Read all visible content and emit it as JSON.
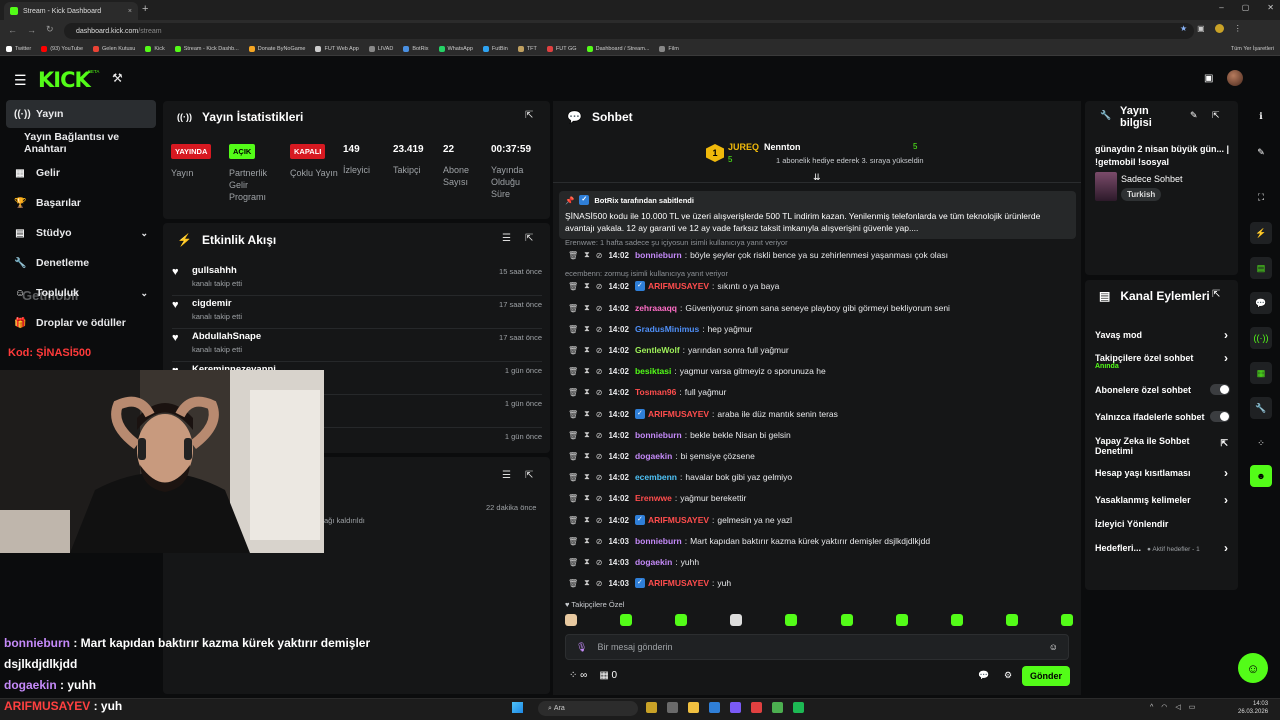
{
  "browser": {
    "tab_title": "Stream - Kick Dashboard",
    "tab_close": "×",
    "new_tab": "+",
    "url_host": "dashboard.kick.com",
    "url_path": "/stream",
    "window_controls": [
      "–",
      "▢",
      "✕"
    ],
    "bookmarks": [
      {
        "label": "Twitter",
        "color": "#ffffff"
      },
      {
        "label": "(93) YouTube",
        "color": "#ff0000"
      },
      {
        "label": "Gelen Kutusu",
        "color": "#ea4335"
      },
      {
        "label": "Kick",
        "color": "#53fc18"
      },
      {
        "label": "Stream - Kick Dashb...",
        "color": "#53fc18"
      },
      {
        "label": "Donate ByNoGame",
        "color": "#f5a623"
      },
      {
        "label": "FUT Web App",
        "color": "#cccccc"
      },
      {
        "label": "LIVAD",
        "color": "#888888"
      },
      {
        "label": "BotRix",
        "color": "#4a90e2"
      },
      {
        "label": "WhatsApp",
        "color": "#25d366"
      },
      {
        "label": "FutBin",
        "color": "#2ea3f2"
      },
      {
        "label": "TFT",
        "color": "#c0a060"
      },
      {
        "label": "FUT GG",
        "color": "#e04040"
      },
      {
        "label": "Dashboard / Stream...",
        "color": "#53fc18"
      },
      {
        "label": "Film",
        "color": "#888888"
      }
    ],
    "all_bookmarks": "Tüm Yer İşaretleri"
  },
  "header": {
    "logo": "KICK",
    "beta": "BETA"
  },
  "sidebar": {
    "items": [
      {
        "label": "Yayın",
        "icon": "broadcast-icon",
        "glyph": "((·))",
        "active": true
      },
      {
        "label": "Yayın Bağlantısı ve Anahtarı",
        "icon": "",
        "glyph": ""
      },
      {
        "label": "Gelir",
        "icon": "chart-icon",
        "glyph": "▦"
      },
      {
        "label": "Başarılar",
        "icon": "trophy-icon",
        "glyph": "🏆"
      },
      {
        "label": "Stüdyo",
        "icon": "studio-icon",
        "glyph": "▤",
        "chevron": true
      },
      {
        "label": "Denetleme",
        "icon": "wrench-icon",
        "glyph": "🔧"
      },
      {
        "label": "Topluluk",
        "icon": "community-icon",
        "glyph": "☺",
        "chevron": true
      },
      {
        "label": "Droplar ve ödüller",
        "icon": "gift-icon",
        "glyph": "🎁"
      }
    ],
    "watermark": "Getmobil",
    "promo": "Kod: ŞİNASİ500"
  },
  "stats": {
    "title": "Yayın İstatistikleri",
    "badges": [
      {
        "badge": "YAYINDA",
        "label": "Yayın"
      },
      {
        "badge": "AÇIK",
        "label": "Partnerlik Gelir Programı"
      },
      {
        "badge": "KAPALI",
        "label": "Çoklu Yayın"
      }
    ],
    "values": [
      {
        "value": "149",
        "label": "İzleyici"
      },
      {
        "value": "23.419",
        "label": "Takipçi"
      },
      {
        "value": "22",
        "label": "Abone Sayısı"
      },
      {
        "value": "00:37:59",
        "label": "Yayında Olduğu Süre"
      }
    ]
  },
  "activity": {
    "title": "Etkinlik Akışı",
    "items": [
      {
        "name": "gullsahhh",
        "sub": "kanalı takip etti",
        "time": "15 saat önce"
      },
      {
        "name": "cigdemir",
        "sub": "kanalı takip etti",
        "time": "17 saat önce"
      },
      {
        "name": "AbdullahSnape",
        "sub": "kanalı takip etti",
        "time": "17 saat önce"
      },
      {
        "name": "Kereminnezevanni",
        "sub": "",
        "time": "1 gün önce"
      },
      {
        "name": "",
        "sub": "",
        "time": "1 gün önce"
      },
      {
        "name": "",
        "sub": "",
        "time": "1 gün önce"
      }
    ]
  },
  "third_panel": {
    "time": "22 dakika önce",
    "sub": "ağı kaldırıldı"
  },
  "chat": {
    "title": "Sohbet",
    "leader1": {
      "name": "JUREQ",
      "count": "5"
    },
    "leader2": {
      "name": "Nennton",
      "count": "5",
      "desc": "1 abonelik hediye ederek 3. sıraya yükseldin"
    },
    "pinned": {
      "by": "BotRix tarafından sabitlendi",
      "text": "ŞİNASİ500 kodu ile 10.000 TL ve üzeri alışverişlerde 500 TL indirim kazan.  Yenilenmiş telefonlarda ve tüm teknolojik ürünlerde avantajı yakala. 12 ay garanti ve 12 ay vade farksız taksit imkanıyla alışverişini güvenle yap...."
    },
    "replies": [
      "Erenwwe: 1 hafta sadece şu içiyosun isimli kullanıcıya yanıt veriyor",
      "ecembenn: zormuş isimli kullanıcıya yanıt veriyor"
    ],
    "messages": [
      {
        "time": "14:02",
        "user": "bonnieburn",
        "color": "#c58af9",
        "kick": false,
        "text": "böyle şeyler çok riskli bence ya su zehirlenmesi yaşanması çok olası"
      },
      {
        "time": "14:02",
        "user": "ARIFMUSAYEV",
        "color": "#ff4d4d",
        "kick": true,
        "text": "sıkıntı o ya baya"
      },
      {
        "time": "14:02",
        "user": "zehraaaqq",
        "color": "#ff6ec7",
        "kick": false,
        "text": "Güveniyoruz şinom sana seneye playboy gibi görmeyi bekliyorum seni"
      },
      {
        "time": "14:02",
        "user": "GradusMinimus",
        "color": "#4f8ff7",
        "kick": false,
        "text": "hep yağmur"
      },
      {
        "time": "14:02",
        "user": "GentleWolf",
        "color": "#9ef05a",
        "kick": false,
        "text": "yarından sonra full yağmur"
      },
      {
        "time": "14:02",
        "user": "besiktasi",
        "color": "#53fc18",
        "kick": false,
        "text": "yagmur varsa gitmeyiz o sporunuza he"
      },
      {
        "time": "14:02",
        "user": "Tosman96",
        "color": "#ff4d4d",
        "kick": false,
        "text": "full yağmur"
      },
      {
        "time": "14:02",
        "user": "ARIFMUSAYEV",
        "color": "#ff4d4d",
        "kick": true,
        "text": "araba ile düz mantık senin teras"
      },
      {
        "time": "14:02",
        "user": "bonnieburn",
        "color": "#c58af9",
        "kick": false,
        "text": "bekle bekle Nisan bi gelsin"
      },
      {
        "time": "14:02",
        "user": "dogaekin",
        "color": "#c58af9",
        "kick": false,
        "text": "bi şemsiye çözsene"
      },
      {
        "time": "14:02",
        "user": "ecembenn",
        "color": "#4fc3f7",
        "kick": false,
        "text": "havalar bok gibi yaz gelmiyo"
      },
      {
        "time": "14:02",
        "user": "Erenwwe",
        "color": "#ff4d4d",
        "kick": false,
        "text": "yağmur berekettir"
      },
      {
        "time": "14:02",
        "user": "ARIFMUSAYEV",
        "color": "#ff4d4d",
        "kick": true,
        "text": "gelmesin ya ne yazl"
      },
      {
        "time": "14:03",
        "user": "bonnieburn",
        "color": "#c58af9",
        "kick": false,
        "text": "Mart kapıdan baktırır kazma kürek yaktırır demişler dsjlkdjdlkjdd"
      },
      {
        "time": "14:03",
        "user": "dogaekin",
        "color": "#c58af9",
        "kick": false,
        "text": "yuhh"
      },
      {
        "time": "14:03",
        "user": "ARIFMUSAYEV",
        "color": "#ff4d4d",
        "kick": true,
        "text": "yuh"
      }
    ],
    "followers_only": "Takipçilere Özel",
    "placeholder": "Bir mesaj gönderin",
    "infinity": "∞",
    "zero": "0",
    "send": "Gönder"
  },
  "overlay": [
    {
      "user": "bonnieburn",
      "text": "Mart kapıdan baktırır kazma kürek yaktırır demişler"
    },
    {
      "user": "",
      "text": "dsjlkdjdlkjdd"
    },
    {
      "user": "dogaekin",
      "text": "yuhh"
    },
    {
      "user": "ARIFMUSAYEV",
      "text": "yuh"
    }
  ],
  "info": {
    "title": "Yayın bilgisi",
    "stream_title": "günaydın 2 nisan büyük gün... | !getmobil !sosyal",
    "category": "Sadece Sohbet",
    "tag": "Turkish"
  },
  "channel": {
    "title": "Kanal Eylemleri",
    "items": [
      {
        "label": "Yavaş mod",
        "kind": "arrow"
      },
      {
        "label": "Takipçilere özel sohbet",
        "kind": "arrow",
        "sub": "Anında"
      },
      {
        "label": "Abonelere özel sohbet",
        "kind": "toggle"
      },
      {
        "label": "Yalnızca ifadelerle sohbet",
        "kind": "toggle"
      },
      {
        "label": "Yapay Zeka ile Sohbet Denetimi",
        "kind": "ext"
      },
      {
        "label": "Hesap yaşı kısıtlaması",
        "kind": "arrow"
      },
      {
        "label": "Yasaklanmış kelimeler",
        "kind": "arrow"
      },
      {
        "label": "İzleyici Yönlendir",
        "kind": "none"
      },
      {
        "label": "Hedefleri...",
        "kind": "arrow",
        "sub": "● Aktif hedefler - 1"
      }
    ]
  },
  "taskbar": {
    "search": "Ara",
    "time": "14:03",
    "date": "26.03.2026"
  }
}
